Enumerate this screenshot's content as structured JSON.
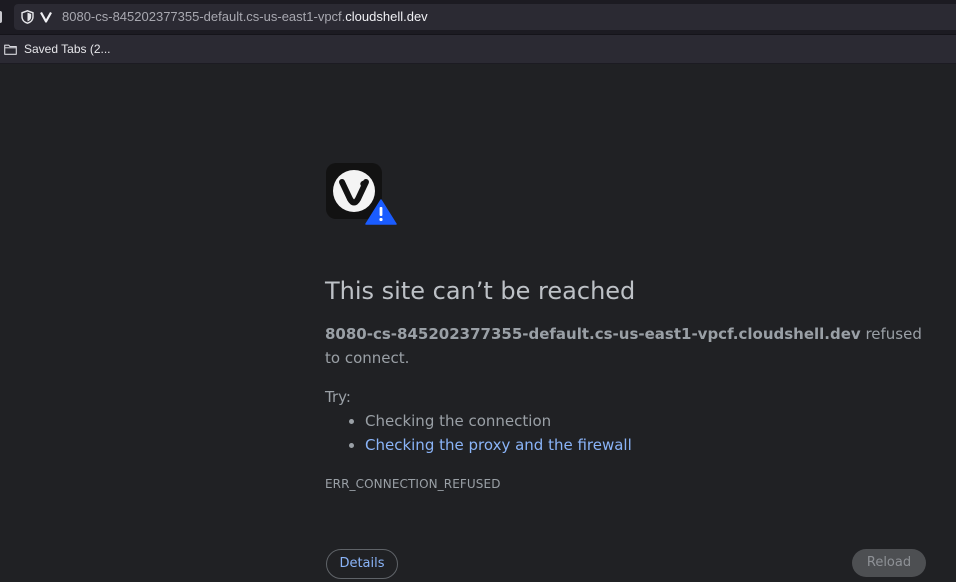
{
  "address_bar": {
    "url_prefix": "8080-cs-845202377355-default.cs-us-east1-vpcf.",
    "url_host": "cloudshell.dev",
    "icons": [
      "shield-icon",
      "vivaldi-v-icon"
    ]
  },
  "bookmarks_bar": {
    "items": [
      {
        "label": "Saved Tabs (2...",
        "icon": "folder-icon"
      }
    ]
  },
  "error_page": {
    "headline": "This site can’t be reached",
    "host": "8080-cs-845202377355-default.cs-us-east1-vpcf.cloudshell.dev",
    "message_suffix": " refused to connect.",
    "try_label": "Try:",
    "suggestions": [
      {
        "label": "Checking the connection",
        "is_link": false
      },
      {
        "label": "Checking the proxy and the firewall",
        "is_link": true
      }
    ],
    "error_code": "ERR_CONNECTION_REFUSED",
    "details_button": "Details",
    "reload_button": "Reload",
    "icons": [
      "browser-logo-icon",
      "warning-icon"
    ]
  },
  "colors": {
    "page_background": "#202124",
    "link": "#8ab4f8",
    "warning_badge": "#1a5cff"
  }
}
